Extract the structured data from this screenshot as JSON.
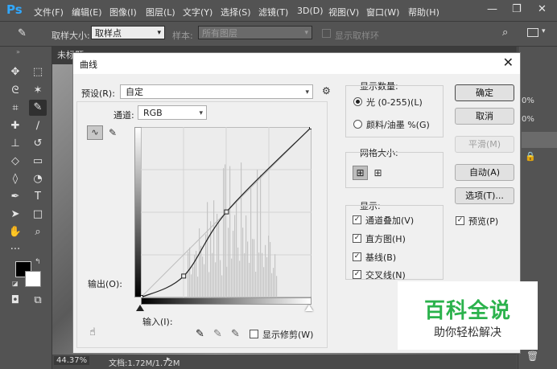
{
  "app": {
    "logo": "Ps"
  },
  "menubar": {
    "items": [
      "文件(F)",
      "编辑(E)",
      "图像(I)",
      "图层(L)",
      "文字(Y)",
      "选择(S)",
      "滤镜(T)",
      "3D(D)",
      "视图(V)",
      "窗口(W)",
      "帮助(H)"
    ],
    "minimize": "—",
    "restore": "❐",
    "close": "✕"
  },
  "options_bar": {
    "sample_size_label": "取样大小:",
    "sample_size_value": "取样点",
    "sample_label": "样本:",
    "sample_value": "所有图层",
    "show_ring_label": "显示取样环"
  },
  "document": {
    "tab_title": "未标题",
    "tab2": "",
    "zoom": "44.37%",
    "doc_info": "文档:1.72M/1.72M"
  },
  "right_panel": {
    "pct1": "0%",
    "pct2": "0%"
  },
  "dialog": {
    "title": "曲线",
    "close": "✕",
    "preset_label": "预设(R):",
    "preset_value": "自定",
    "channel_label": "通道:",
    "channel_value": "RGB",
    "output_label": "输出(O):",
    "input_label": "输入(I):",
    "show_clipping": "显示修剪(W)",
    "display_amount": {
      "title": "显示数量:",
      "light": "光 (0-255)(L)",
      "pigment": "颜料/油墨 %(G)",
      "selected": "light"
    },
    "grid_size": {
      "title": "网格大小:"
    },
    "show": {
      "title": "显示:",
      "channel_overlay": "通道叠加(V)",
      "histogram": "直方图(H)",
      "baseline": "基线(B)",
      "intersection": "交叉线(N)"
    },
    "buttons": {
      "ok": "确定",
      "cancel": "取消",
      "smooth": "平滑(M)",
      "auto": "自动(A)",
      "options": "选项(T)...",
      "preview": "预览(P)"
    },
    "curve_points": [
      [
        0,
        0
      ],
      [
        64,
        32
      ],
      [
        128,
        128
      ],
      [
        255,
        255
      ]
    ]
  },
  "watermark": {
    "title": "百科全说",
    "subtitle": "助你轻松解决"
  }
}
